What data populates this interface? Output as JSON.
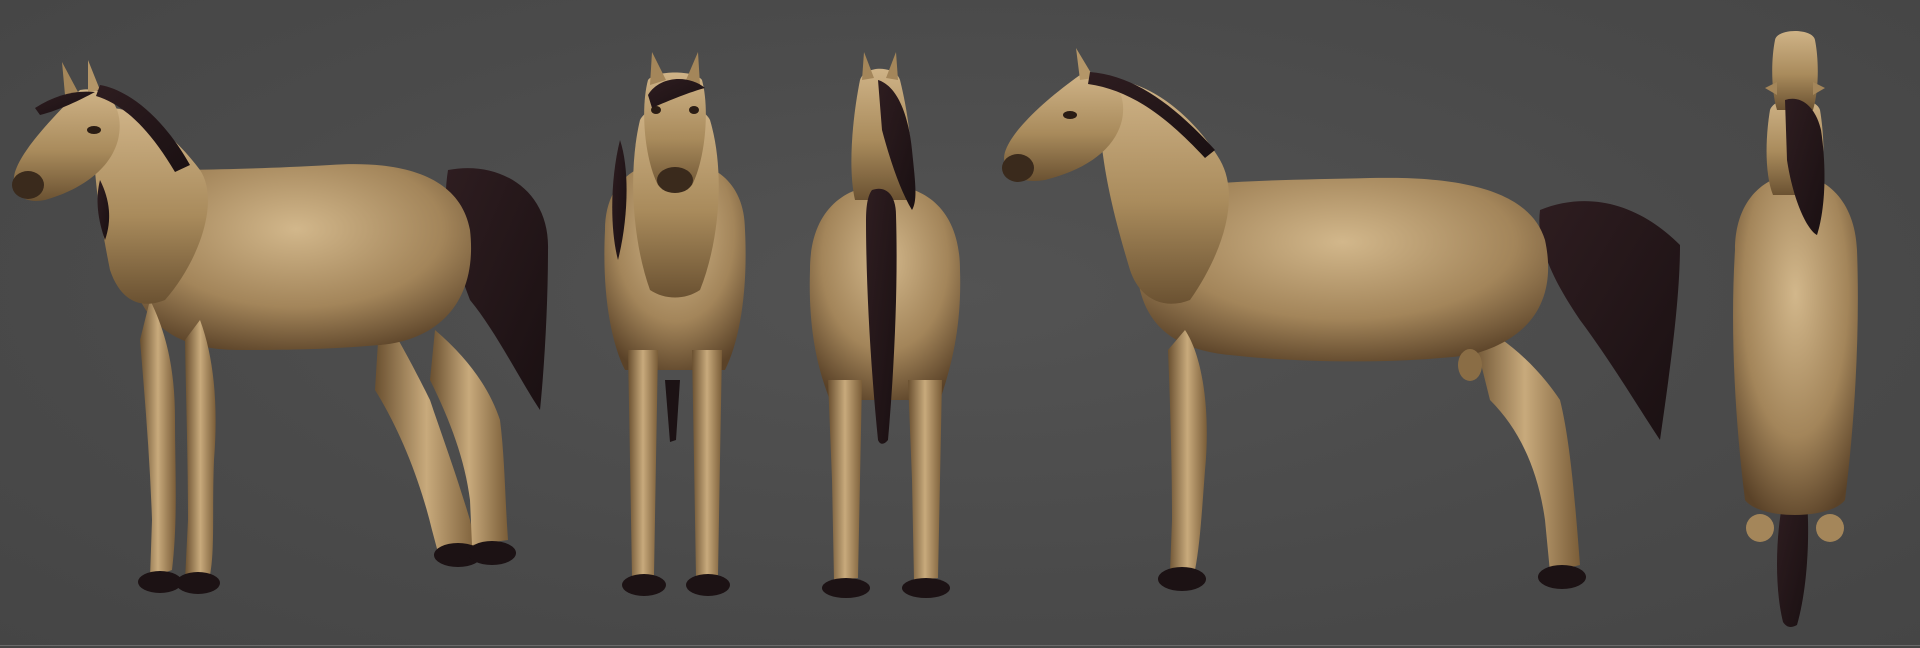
{
  "scene": {
    "kind": "3d-sculpt-turnaround",
    "subject": "horse",
    "background": "#4c4c4c",
    "colors": {
      "coat_light": "#cdb185",
      "coat_mid": "#a6885a",
      "coat_dark": "#4e3a22",
      "hair": "#241719",
      "hoof": "#1c1214"
    },
    "views": [
      "three-quarter-front",
      "front",
      "back",
      "side",
      "top"
    ]
  }
}
